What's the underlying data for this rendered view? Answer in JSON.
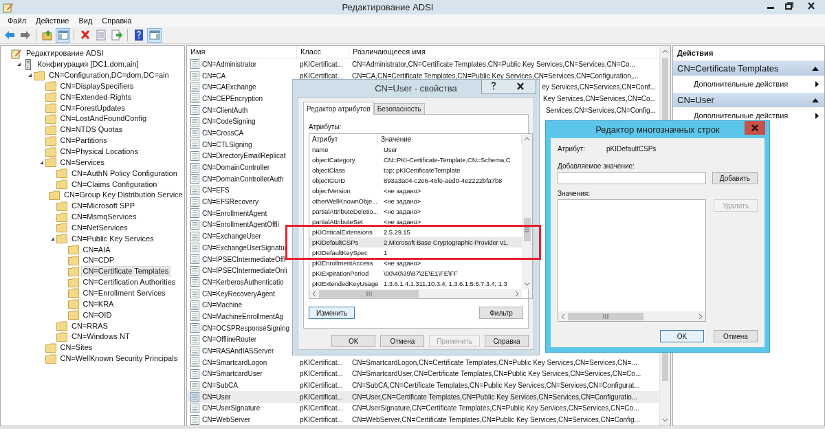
{
  "window": {
    "title": "Редактирование ADSI"
  },
  "menu": [
    "Файл",
    "Действие",
    "Вид",
    "Справка"
  ],
  "toolbar": [
    [
      {
        "kind": "back",
        "pressed": false
      },
      {
        "kind": "forward",
        "pressed": false
      }
    ],
    [
      {
        "kind": "up",
        "pressed": false
      },
      {
        "kind": "console-tree",
        "pressed": true
      }
    ],
    [
      {
        "kind": "delete",
        "pressed": false
      },
      {
        "kind": "properties",
        "pressed": false
      },
      {
        "kind": "export",
        "pressed": false
      }
    ],
    [
      {
        "kind": "help",
        "pressed": false
      },
      {
        "kind": "action-pane",
        "pressed": true
      }
    ]
  ],
  "tree": [
    {
      "label": "Редактирование ADSI",
      "kind": "adsi",
      "selected": false,
      "children": [
        {
          "label": "Конфигурация [DC1.dom.ain]",
          "kind": "server",
          "selected": false,
          "expanded": true,
          "children": [
            {
              "label": "CN=Configuration,DC=dom,DC=ain",
              "kind": "folder",
              "selected": false,
              "expanded": true,
              "children": [
                {
                  "label": "CN=DisplaySpecifiers",
                  "kind": "folder",
                  "selected": false
                },
                {
                  "label": "CN=Extended-Rights",
                  "kind": "folder",
                  "selected": false
                },
                {
                  "label": "CN=ForestUpdates",
                  "kind": "folder",
                  "selected": false
                },
                {
                  "label": "CN=LostAndFoundConfig",
                  "kind": "folder",
                  "selected": false
                },
                {
                  "label": "CN=NTDS Quotas",
                  "kind": "folder",
                  "selected": false
                },
                {
                  "label": "CN=Partitions",
                  "kind": "folder",
                  "selected": false
                },
                {
                  "label": "CN=Physical Locations",
                  "kind": "folder",
                  "selected": false
                },
                {
                  "label": "CN=Services",
                  "kind": "folder",
                  "selected": false,
                  "expanded": true,
                  "children": [
                    {
                      "label": "CN=AuthN Policy Configuration",
                      "kind": "folder",
                      "selected": false
                    },
                    {
                      "label": "CN=Claims Configuration",
                      "kind": "folder",
                      "selected": false
                    },
                    {
                      "label": "CN=Group Key Distribution Service",
                      "kind": "folder",
                      "selected": false
                    },
                    {
                      "label": "CN=Microsoft SPP",
                      "kind": "folder",
                      "selected": false
                    },
                    {
                      "label": "CN=MsmqServices",
                      "kind": "folder",
                      "selected": false
                    },
                    {
                      "label": "CN=NetServices",
                      "kind": "folder",
                      "selected": false
                    },
                    {
                      "label": "CN=Public Key Services",
                      "kind": "folder",
                      "selected": false,
                      "expanded": true,
                      "children": [
                        {
                          "label": "CN=AIA",
                          "kind": "folder",
                          "selected": false
                        },
                        {
                          "label": "CN=CDP",
                          "kind": "folder",
                          "selected": false
                        },
                        {
                          "label": "CN=Certificate Templates",
                          "kind": "folder",
                          "selected": true
                        },
                        {
                          "label": "CN=Certification Authorities",
                          "kind": "folder",
                          "selected": false
                        },
                        {
                          "label": "CN=Enrollment Services",
                          "kind": "folder",
                          "selected": false
                        },
                        {
                          "label": "CN=KRA",
                          "kind": "folder",
                          "selected": false
                        },
                        {
                          "label": "CN=OID",
                          "kind": "folder",
                          "selected": false
                        }
                      ]
                    },
                    {
                      "label": "CN=RRAS",
                      "kind": "folder",
                      "selected": false
                    },
                    {
                      "label": "CN=Windows NT",
                      "kind": "folder",
                      "selected": false
                    }
                  ]
                },
                {
                  "label": "CN=Sites",
                  "kind": "folder",
                  "selected": false
                },
                {
                  "label": "CN=WellKnown Security Principals",
                  "kind": "folder",
                  "selected": false
                }
              ]
            }
          ]
        }
      ]
    }
  ],
  "list": {
    "columns": [
      "Имя",
      "Класс",
      "Различающееся имя"
    ],
    "rows": [
      {
        "name": "CN=Administrator",
        "class": "pKICertificat...",
        "dn": "CN=Administrator,CN=Certificate Templates,CN=Public Key Services,CN=Services,CN=Co...",
        "kind": "full",
        "selected": false
      },
      {
        "name": "CN=CA",
        "class": "pKICertificat...",
        "dn": "CN=CA,CN=Certificate Templates,CN=Public Key Services,CN=Services,CN=Configuration,...",
        "kind": "full",
        "selected": false
      },
      {
        "name": "CN=CAExchange",
        "dn": "ey Services,CN=Services,CN=Conf...",
        "kind": "tail",
        "selected": false
      },
      {
        "name": "CN=CEPEncryption",
        "dn": "Key Services,CN=Services,CN=Co...",
        "kind": "tail",
        "selected": false
      },
      {
        "name": "CN=ClientAuth",
        "dn": "Services,CN=Services,CN=Config...",
        "kind": "tail",
        "selected": false
      },
      {
        "name": "CN=CodeSigning",
        "selected": false
      },
      {
        "name": "CN=CrossCA",
        "selected": false
      },
      {
        "name": "CN=CTLSigning",
        "selected": false
      },
      {
        "name": "CN=DirectoryEmailReplicat",
        "selected": false
      },
      {
        "name": "CN=DomainController",
        "selected": false
      },
      {
        "name": "CN=DomainControllerAuth",
        "selected": false
      },
      {
        "name": "CN=EFS",
        "selected": false
      },
      {
        "name": "CN=EFSRecovery",
        "selected": false
      },
      {
        "name": "CN=EnrollmentAgent",
        "selected": false
      },
      {
        "name": "CN=EnrollmentAgentOffli",
        "selected": false
      },
      {
        "name": "CN=ExchangeUser",
        "selected": false
      },
      {
        "name": "CN=ExchangeUserSignatur",
        "selected": false
      },
      {
        "name": "CN=IPSECIntermediateOffl",
        "selected": false
      },
      {
        "name": "CN=IPSECIntermediateOnli",
        "selected": false
      },
      {
        "name": "CN=KerberosAuthenticatio",
        "selected": false
      },
      {
        "name": "CN=KeyRecoveryAgent",
        "selected": false
      },
      {
        "name": "CN=Machine",
        "selected": false
      },
      {
        "name": "CN=MachineEnrollmentAg",
        "selected": false
      },
      {
        "name": "CN=OCSPResponseSigning",
        "selected": false
      },
      {
        "name": "CN=OfflineRouter",
        "selected": false
      },
      {
        "name": "CN=RASAndIASServer",
        "selected": false
      },
      {
        "name": "CN=SmartcardLogon",
        "class": "pKICertificat...",
        "dn": "CN=SmartcardLogon,CN=Certificate Templates,CN=Public Key Services,CN=Services,CN=...",
        "kind": "full",
        "selected": false
      },
      {
        "name": "CN=SmartcardUser",
        "class": "pKICertificat...",
        "dn": "CN=SmartcardUser,CN=Certificate Templates,CN=Public Key Services,CN=Services,CN=Co...",
        "kind": "full",
        "selected": false
      },
      {
        "name": "CN=SubCA",
        "class": "pKICertificat...",
        "dn": "CN=SubCA,CN=Certificate Templates,CN=Public Key Services,CN=Services,CN=Configurat...",
        "kind": "full",
        "selected": false
      },
      {
        "name": "CN=User",
        "class": "pKICertificat...",
        "dn": "CN=User,CN=Certificate Templates,CN=Public Key Services,CN=Services,CN=Configuratio...",
        "kind": "full",
        "selected": true
      },
      {
        "name": "CN=UserSignature",
        "class": "pKICertificat...",
        "dn": "CN=UserSignature,CN=Certificate Templates,CN=Public Key Services,CN=Services,CN=Co...",
        "kind": "full",
        "selected": false
      },
      {
        "name": "CN=WebServer",
        "class": "pKICertificat...",
        "dn": "CN=WebServer,CN=Certificate Templates,CN=Public Key Services,CN=Services,CN=Config...",
        "kind": "full",
        "selected": false
      }
    ]
  },
  "actions": {
    "title": "Действия",
    "sections": [
      {
        "title": "CN=Certificate Templates",
        "items": [
          "Дополнительные действия"
        ]
      },
      {
        "title": "CN=User",
        "items": [
          "Дополнительные действия"
        ]
      }
    ]
  },
  "properties_dialog": {
    "title": "CN=User - свойства",
    "tabs": [
      {
        "label": "Редактор атрибутов",
        "selected": true
      },
      {
        "label": "Безопасность",
        "selected": false
      }
    ],
    "attributes_label": "Атрибуты:",
    "columns": [
      "Атрибут",
      "Значение"
    ],
    "row_groups": [
      {
        "framed": false,
        "rows": [
          {
            "attribute": "name",
            "value": "User",
            "selected": false
          },
          {
            "attribute": "objectCategory",
            "value": "CN=PKI-Certificate-Template,CN=Schema,C",
            "selected": false
          },
          {
            "attribute": "objectClass",
            "value": "top; pKICertificateTemplate",
            "selected": false
          },
          {
            "attribute": "objectGUID",
            "value": "893a3a04-c2e6-46fe-aed0-4e2222bfa7b8",
            "selected": false
          },
          {
            "attribute": "objectVersion",
            "value": "<не задано>",
            "selected": false
          },
          {
            "attribute": "otherWellKnownObje...",
            "value": "<не задано>",
            "selected": false
          },
          {
            "attribute": "partialAttributeDeletio...",
            "value": "<не задано>",
            "selected": false
          },
          {
            "attribute": "partialAttributeSet",
            "value": "<не задано>",
            "selected": false
          }
        ]
      },
      {
        "framed": true,
        "rows": [
          {
            "attribute": "pKICriticalExtensions",
            "value": "2.5.29.15",
            "selected": false
          },
          {
            "attribute": "pKIDefaultCSPs",
            "value": "2,Microsoft Base Cryptographic Provider v1.",
            "selected": true
          },
          {
            "attribute": "pKIDefaultKeySpec",
            "value": "1",
            "selected": false
          }
        ]
      },
      {
        "framed": false,
        "rows": [
          {
            "attribute": "pKIEnrollmentAccess",
            "value": "<не задано>",
            "selected": false
          },
          {
            "attribute": "pKIExpirationPeriod",
            "value": "\\00\\40\\39\\87\\2E\\E1\\FE\\FF",
            "selected": false
          },
          {
            "attribute": "pKIExtendedKeyUsage",
            "value": "1.3.6.1.4.1.311.10.3.4; 1.3.6.1.5.5.7.3.4; 1.3",
            "selected": false
          }
        ]
      }
    ],
    "edit_button": {
      "label": "Изменить",
      "focused": true
    },
    "filter_button": {
      "label": "Фильтр",
      "focused": false
    },
    "buttons": [
      {
        "label": "OK",
        "disabled": false
      },
      {
        "label": "Отмена",
        "disabled": false
      },
      {
        "label": "Применить",
        "disabled": true
      },
      {
        "label": "Справка",
        "disabled": false
      }
    ]
  },
  "multistring_dialog": {
    "title": "Редактор многозначных строк",
    "attribute_label": "Атрибут:",
    "attribute": "pKIDefaultCSPs",
    "add_label": "Добавляемое значение:",
    "add_button": "Добавить",
    "values_label": "Значения:",
    "remove_button": {
      "label": "Удалить",
      "disabled": true
    },
    "buttons": [
      {
        "label": "OK",
        "focused": true
      },
      {
        "label": "Отмена",
        "focused": false
      }
    ]
  }
}
